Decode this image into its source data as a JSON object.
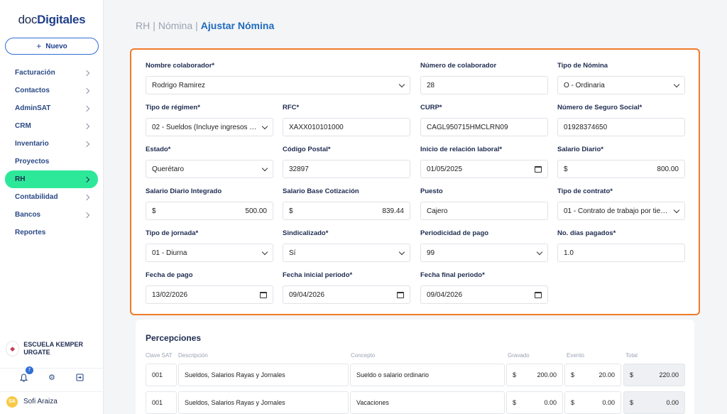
{
  "app": {
    "logo_light": "doc",
    "logo_bold": "Digitales"
  },
  "sidebar": {
    "new_button": "Nuevo",
    "items": [
      {
        "label": "Facturación",
        "has_chevron": true
      },
      {
        "label": "Contactos",
        "has_chevron": true
      },
      {
        "label": "AdminSAT",
        "has_chevron": true
      },
      {
        "label": "CRM",
        "has_chevron": true
      },
      {
        "label": "Inventario",
        "has_chevron": true
      },
      {
        "label": "Proyectos",
        "has_chevron": false
      },
      {
        "label": "RH",
        "has_chevron": true,
        "active": true
      },
      {
        "label": "Contabilidad",
        "has_chevron": true
      },
      {
        "label": "Bancos",
        "has_chevron": true
      },
      {
        "label": "Reportes",
        "has_chevron": false
      }
    ],
    "company": "ESCUELA KEMPER URGATE",
    "notifications_count": "7",
    "user": {
      "initials": "SA",
      "name": "Sofi Araiza"
    }
  },
  "breadcrumb": {
    "part1": "RH",
    "part2": "Nómina",
    "current": "Ajustar Nómina"
  },
  "form": {
    "nombre_colaborador": {
      "label": "Nombre colaborador*",
      "value": "Rodrigo Ramirez"
    },
    "numero_colaborador": {
      "label": "Número de colaborador",
      "value": "28"
    },
    "tipo_nomina": {
      "label": "Tipo de Nómina",
      "value": "O - Ordinaria"
    },
    "tipo_regimen": {
      "label": "Tipo de régimen*",
      "value": "02 - Sueldos (Incluye ingresos se..."
    },
    "rfc": {
      "label": "RFC*",
      "value": "XAXX010101000"
    },
    "curp": {
      "label": "CURP*",
      "value": "CAGL950715HMCLRN09"
    },
    "nss": {
      "label": "Número de Seguro Social*",
      "value": "01928374650"
    },
    "estado": {
      "label": "Estado*",
      "value": "Querétaro"
    },
    "codigo_postal": {
      "label": "Código Postal*",
      "value": "32897"
    },
    "inicio_relacion": {
      "label": "Inicio de relación laboral*",
      "value": "01/05/2025"
    },
    "salario_diario": {
      "label": "Salario Diario*",
      "currency": "$",
      "value": "800.00"
    },
    "salario_integrado": {
      "label": "Salario Diario Integrado",
      "currency": "$",
      "value": "500.00"
    },
    "salario_base": {
      "label": "Salario Base Cotización",
      "currency": "$",
      "value": "839.44"
    },
    "puesto": {
      "label": "Puesto",
      "value": "Cajero"
    },
    "tipo_contrato": {
      "label": "Tipo de contrato*",
      "value": "01 - Contrato de trabajo por tiem..."
    },
    "tipo_jornada": {
      "label": "Tipo de jornada*",
      "value": "01 - Diurna"
    },
    "sindicalizado": {
      "label": "Sindicalizado*",
      "value": "Sí"
    },
    "periodicidad": {
      "label": "Periodicidad de pago",
      "value": "99"
    },
    "dias_pagados": {
      "label": "No. días pagados*",
      "value": "1.0"
    },
    "fecha_pago": {
      "label": "Fecha de pago",
      "value": "13/02/2026"
    },
    "fecha_inicial": {
      "label": "Fecha inicial periodo*",
      "value": "09/04/2026"
    },
    "fecha_final": {
      "label": "Fecha final periodo*",
      "value": "09/04/2026"
    }
  },
  "percepciones": {
    "title": "Percepciones",
    "headers": [
      "Clave SAT",
      "Descripción",
      "Concepto",
      "Gravado",
      "Exento",
      "Total"
    ],
    "rows": [
      {
        "clave": "001",
        "descripcion": "Sueldos, Salarios Rayas y Jornales",
        "concepto": "Sueldo o salario ordinario",
        "gravado": "200.00",
        "exento": "20.00",
        "total": "220.00"
      },
      {
        "clave": "001",
        "descripcion": "Sueldos, Salarios Rayas y Jornales",
        "concepto": "Vacaciones",
        "gravado": "0.00",
        "exento": "0.00",
        "total": "0.00"
      }
    ],
    "currency": "$"
  }
}
